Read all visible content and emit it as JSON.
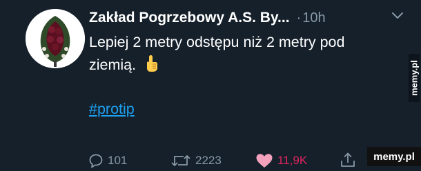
{
  "tweet": {
    "author_name": "Zakład Pogrzebowy A.S. By...",
    "separator": "·",
    "time": "10h",
    "text": "Lepiej 2 metry odstępu niż 2 metry pod ziemią.",
    "hashtag": "#protip"
  },
  "actions": {
    "replies": "101",
    "retweets": "2223",
    "likes": "11,9K"
  },
  "watermarks": {
    "side": "memy.pl",
    "bottom": "memy.pl"
  },
  "colors": {
    "background": "#15202b",
    "secondary_text": "#8899a6",
    "link": "#1da1f2",
    "like": "#e0245e"
  },
  "icons": {
    "reply": "comment-bubble-icon",
    "retweet": "retweet-icon",
    "like": "heart-icon",
    "share": "share-icon",
    "menu": "chevron-down-icon",
    "emoji": "pointing-up-emoji"
  }
}
